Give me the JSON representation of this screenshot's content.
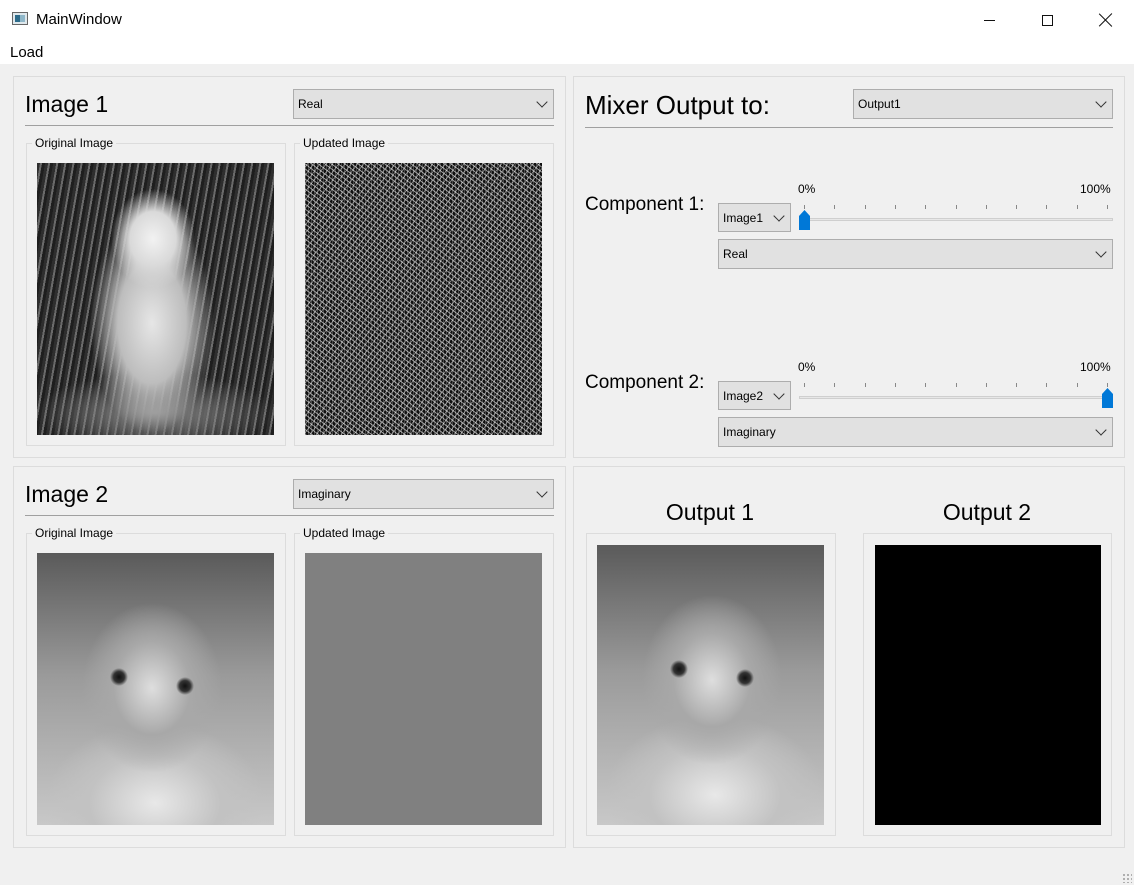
{
  "window": {
    "title": "MainWindow"
  },
  "menu": {
    "items": [
      {
        "label": "Load"
      }
    ]
  },
  "image1": {
    "title": "Image 1",
    "component": "Real",
    "original_label": "Original Image",
    "updated_label": "Updated Image"
  },
  "image2": {
    "title": "Image 2",
    "component": "Imaginary",
    "original_label": "Original Image",
    "updated_label": "Updated Image"
  },
  "mixer": {
    "title": "Mixer Output to:",
    "output_target": "Output1",
    "component1": {
      "label": "Component 1:",
      "source": "Image1",
      "min_label": "0%",
      "max_label": "100%",
      "value_percent": 0,
      "type": "Real"
    },
    "component2": {
      "label": "Component 2:",
      "source": "Image2",
      "min_label": "0%",
      "max_label": "100%",
      "value_percent": 100,
      "type": "Imaginary"
    }
  },
  "outputs": {
    "output1_title": "Output 1",
    "output2_title": "Output 2"
  },
  "colors": {
    "accent": "#0078d7",
    "background": "#f0f0f0"
  },
  "icons": [
    "app-icon",
    "minimize-icon",
    "maximize-icon",
    "close-icon",
    "chevron-down-icon"
  ]
}
